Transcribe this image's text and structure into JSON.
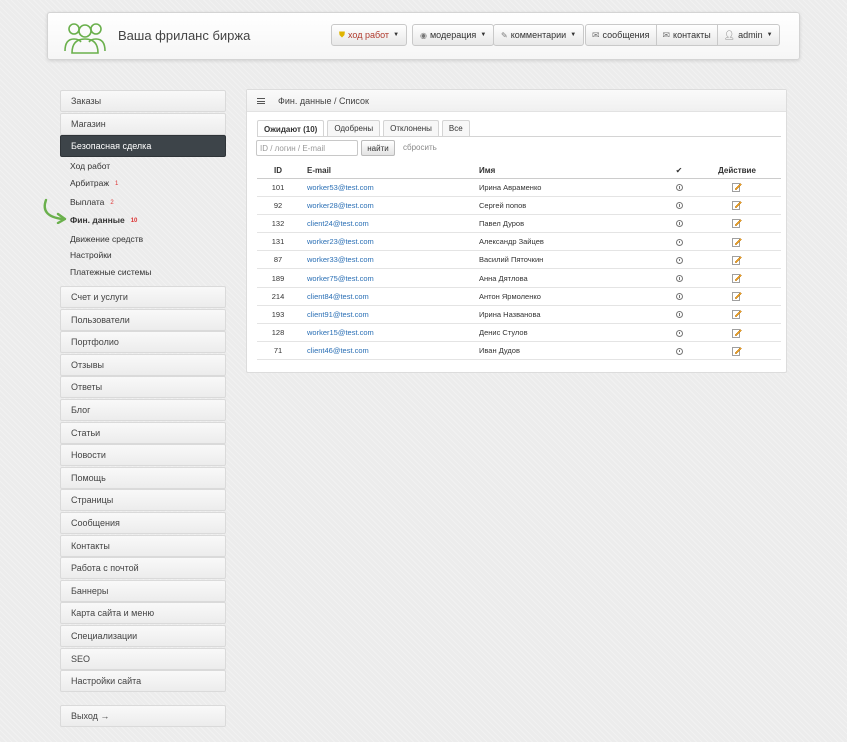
{
  "header": {
    "brand": "Ваша фриланс биржа",
    "nav_progress": "ход работ",
    "nav_moderation": "модерация",
    "nav_comments": "комментарии",
    "nav_messages": "сообщения",
    "nav_contacts": "контакты",
    "nav_user": "admin"
  },
  "sidebar": {
    "top": [
      "Заказы",
      "Магазин"
    ],
    "active": "Безопасная сделка",
    "sub": [
      {
        "label": "Ход работ",
        "badge": ""
      },
      {
        "label": "Арбитраж",
        "badge": "1"
      },
      {
        "label": "Выплата",
        "badge": "2"
      },
      {
        "label": "Фин. данные",
        "badge": "10"
      },
      {
        "label": "Движение средств",
        "badge": ""
      },
      {
        "label": "Настройки",
        "badge": ""
      },
      {
        "label": "Платежные системы",
        "badge": ""
      }
    ],
    "items": [
      "Счет и услуги",
      "Пользователи",
      "Портфолио",
      "Отзывы",
      "Ответы",
      "Блог",
      "Статьи",
      "Новости",
      "Помощь",
      "Страницы",
      "Сообщения",
      "Контакты",
      "Работа с почтой",
      "Баннеры",
      "Карта сайта и меню",
      "Специализации",
      "SEO",
      "Настройки сайта"
    ],
    "logout": "Выход →"
  },
  "panel": {
    "title": "Фин. данные / Список",
    "tabs": [
      "Ожидают (10)",
      "Одобрены",
      "Отклонены",
      "Все"
    ],
    "search_placeholder": "ID / логин / E-mail",
    "search_button": "найти",
    "reset": "сбросить",
    "columns": {
      "id": "ID",
      "email": "E-mail",
      "name": "Имя",
      "check": "✔",
      "action": "Действие"
    },
    "rows": [
      {
        "id": "101",
        "email": "worker53@test.com",
        "name": "Ирина Авраменко"
      },
      {
        "id": "92",
        "email": "worker28@test.com",
        "name": "Сергей попов"
      },
      {
        "id": "132",
        "email": "client24@test.com",
        "name": "Павел Дуров"
      },
      {
        "id": "131",
        "email": "worker23@test.com",
        "name": "Александр Зайцев"
      },
      {
        "id": "87",
        "email": "worker33@test.com",
        "name": "Василий Пяточкин"
      },
      {
        "id": "189",
        "email": "worker75@test.com",
        "name": "Анна Дятлова"
      },
      {
        "id": "214",
        "email": "client84@test.com",
        "name": "Антон Ярмоленко"
      },
      {
        "id": "193",
        "email": "client91@test.com",
        "name": "Ирина Названова"
      },
      {
        "id": "128",
        "email": "worker15@test.com",
        "name": "Денис Стулов"
      },
      {
        "id": "71",
        "email": "client46@test.com",
        "name": "Иван Дудов"
      }
    ]
  },
  "colors": {
    "accent_green": "#6ab04c",
    "active_bg": "#3d4449",
    "link": "#2a6fb5",
    "badge_red": "#dd3333"
  }
}
